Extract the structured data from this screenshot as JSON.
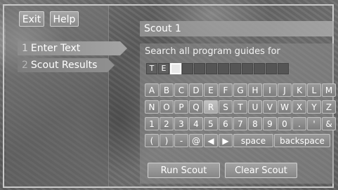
{
  "top_buttons": {
    "exit": "Exit",
    "help": "Help"
  },
  "menu": [
    {
      "number": "1",
      "label": "Enter Text"
    },
    {
      "number": "2",
      "label": "Scout Results"
    }
  ],
  "title": "Scout 1",
  "prompt": "Search all program guides for",
  "entry": {
    "text": "TE",
    "total_cells": 12
  },
  "keyboard": {
    "highlighted_key": "R",
    "rows": [
      [
        "A",
        "B",
        "C",
        "D",
        "E",
        "F",
        "G",
        "H",
        "I",
        "J",
        "K",
        "L",
        "M"
      ],
      [
        "N",
        "O",
        "P",
        "Q",
        "R",
        "S",
        "T",
        "U",
        "V",
        "W",
        "X",
        "Y",
        "Z"
      ],
      [
        "1",
        "2",
        "3",
        "4",
        "5",
        "6",
        "7",
        "8",
        "9",
        "0",
        ".",
        "'",
        "&"
      ],
      [
        "(",
        ")",
        "-",
        "@",
        "◀",
        "▶",
        "space",
        "backspace"
      ]
    ]
  },
  "actions": {
    "run": "Run Scout",
    "clear": "Clear Scout"
  }
}
